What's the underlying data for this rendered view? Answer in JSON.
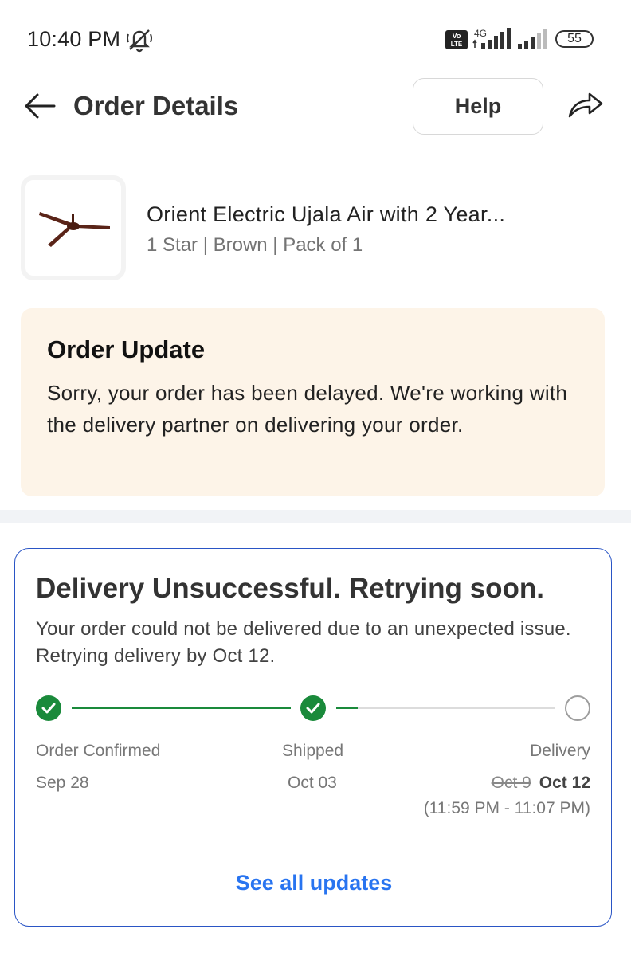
{
  "status_bar": {
    "time": "10:40 PM",
    "network_label": "4G",
    "volte_label": "Vo LTE",
    "battery": "55"
  },
  "header": {
    "title": "Order Details",
    "help_label": "Help"
  },
  "product": {
    "name": "Orient Electric Ujala Air with 2 Year...",
    "variant": "1 Star | Brown | Pack of 1"
  },
  "order_update": {
    "title": "Order Update",
    "message": "Sorry, your order has been delayed. We're working with the delivery partner on delivering your order."
  },
  "delivery": {
    "title": "Delivery Unsuccessful. Retrying soon.",
    "message": "Your order could not be delivered due to an unexpected issue. Retrying delivery by Oct 12.",
    "steps": [
      {
        "label": "Order Confirmed",
        "date": "Sep 28",
        "status": "done"
      },
      {
        "label": "Shipped",
        "date": "Oct 03",
        "status": "done"
      },
      {
        "label": "Delivery",
        "old_date": "Oct 9",
        "new_date": "Oct 12",
        "status": "pending"
      }
    ],
    "delivery_window": "(11:59 PM - 11:07 PM)",
    "see_all_label": "See all updates",
    "colors": {
      "done": "#1a8a3b",
      "pending_line": "#dcdcdc",
      "link": "#2874f0",
      "card_border": "#2a55c5"
    }
  }
}
